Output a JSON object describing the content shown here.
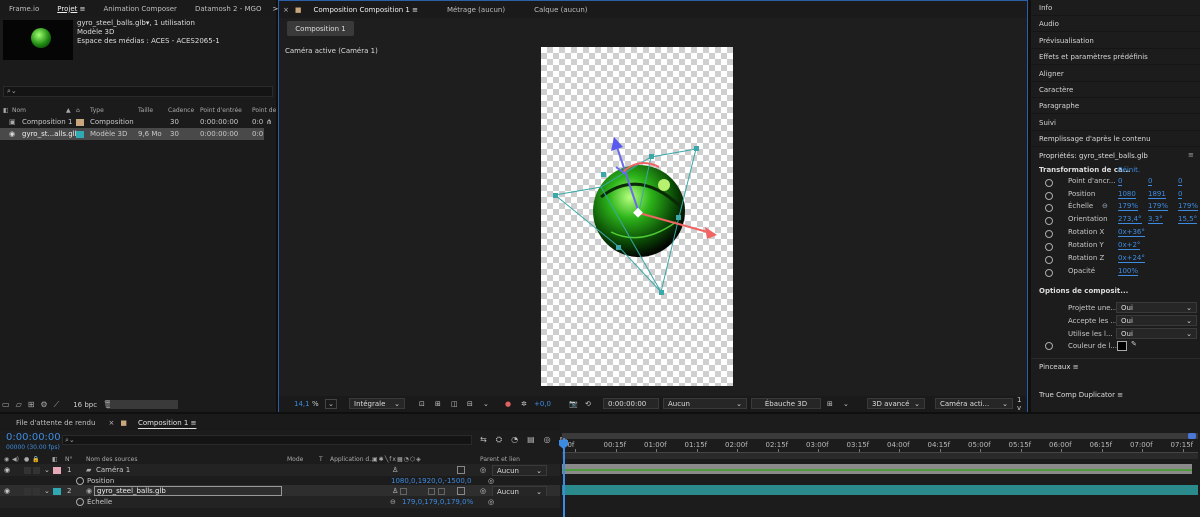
{
  "top_tabs": {
    "frameio": "Frame.io",
    "projet": "Projet",
    "animation_composer": "Animation Composer",
    "datamosh": "Datamosh 2 - MGO",
    "more": ">>"
  },
  "project": {
    "item_name": "gyro_steel_balls.glb▾",
    "item_usage": ", 1 utilisation",
    "item_type_line": "Modèle 3D",
    "item_colorspace": "Espace des médias : ACES - ACES2065-1",
    "search_placeholder": "",
    "columns": [
      "Nom",
      "Type",
      "Taille",
      "Cadence",
      "Point d'entrée",
      "Point de"
    ],
    "rows": [
      {
        "name": "Composition 1",
        "type": "Composition",
        "size": "",
        "rate": "30",
        "in": "0:00:00:00",
        "out": "0:0",
        "swatch": "#c9a77c"
      },
      {
        "name": "gyro_st...alls.glb",
        "type": "Modèle 3D",
        "size": "9,6 Mo",
        "rate": "30",
        "in": "0:00:00:00",
        "out": "0:0",
        "swatch": "#2fa9b3"
      }
    ],
    "bpc": "16 bpc"
  },
  "viewer": {
    "tabs": {
      "composition": "Composition Composition 1",
      "metrage": "Métrage (aucun)",
      "calque": "Calque (aucun)"
    },
    "comp_button": "Composition 1",
    "camera_label": "Caméra active (Caméra 1)",
    "footer": {
      "zoom": "14,1",
      "zoom_unit": "%",
      "resolution": "Intégrale",
      "exposure": "+0,0",
      "timecode": "0:00:00:00",
      "none_select": "Aucun",
      "draft3d": "Ébauche 3D",
      "renderer": "3D avancé",
      "camera": "Caméra acti...",
      "views": "1 v"
    }
  },
  "right_panel": {
    "items": [
      "Info",
      "Audio",
      "Prévisualisation",
      "Effets et paramètres prédéfinis",
      "Aligner",
      "Caractère",
      "Paragraphe",
      "Suivi",
      "Remplissage d'après le contenu"
    ],
    "properties_title": "Propriétés: gyro_steel_balls.glb",
    "transform_title": "Transformation de ca...",
    "reset": "Réinit.",
    "props": [
      {
        "label": "Point d'ancr...",
        "v1": "0",
        "v2": "0",
        "v3": "0"
      },
      {
        "label": "Position",
        "v1": "1080",
        "v2": "1891",
        "v3": "0"
      },
      {
        "label": "Échelle",
        "v1": "179%",
        "v2": "179%",
        "v3": "179%"
      },
      {
        "label": "Orientation",
        "v1": "273,4°",
        "v2": "3,3°",
        "v3": "15,5°"
      },
      {
        "label": "Rotation X",
        "v1": "0x+36°"
      },
      {
        "label": "Rotation Y",
        "v1": "0x+2°"
      },
      {
        "label": "Rotation Z",
        "v1": "0x+24°"
      },
      {
        "label": "Opacité",
        "v1": "100%"
      }
    ],
    "comp_options_title": "Options de composit...",
    "options": [
      {
        "label": "Projette une...",
        "value": "Oui"
      },
      {
        "label": "Accepte les ...",
        "value": "Oui"
      },
      {
        "label": "Utilise les l...",
        "value": "Oui"
      }
    ],
    "light_color_label": "Couleur de l...",
    "pinceaux": "Pinceaux",
    "true_comp": "True Comp Duplicator"
  },
  "timeline": {
    "tabs": {
      "render_queue": "File d'attente de rendu",
      "composition": "Composition 1"
    },
    "timecode": "0:00:00:00",
    "fps": "00000 (30.00 fps)",
    "headers": {
      "n": "N°",
      "source": "Nom des sources",
      "mode": "Mode",
      "t": "T",
      "app": "Application d...",
      "parent": "Parent et lien"
    },
    "layers": [
      {
        "num": "1",
        "name": "Caméra 1",
        "parent": "Aucun",
        "swatch": "#e6a8b8"
      },
      {
        "num": "2",
        "name": "gyro_steel_balls.glb",
        "parent": "Aucun",
        "swatch": "#2fa9b3"
      }
    ],
    "props": [
      {
        "name": "Position",
        "value": "1080,0,1920,0,-1500,0"
      },
      {
        "name": "Échelle",
        "value": "179,0,179,0,179,0%"
      }
    ],
    "ruler": [
      "00f",
      "00:15f",
      "01:00f",
      "01:15f",
      "02:00f",
      "02:15f",
      "03:00f",
      "03:15f",
      "04:00f",
      "04:15f",
      "05:00f",
      "05:15f",
      "06:00f",
      "06:15f",
      "07:00f",
      "07:15f"
    ]
  },
  "colors": {
    "accent": "#3d8be0",
    "teal_bar": "#2a8a8c",
    "green_bar": "#4f9a3a"
  }
}
